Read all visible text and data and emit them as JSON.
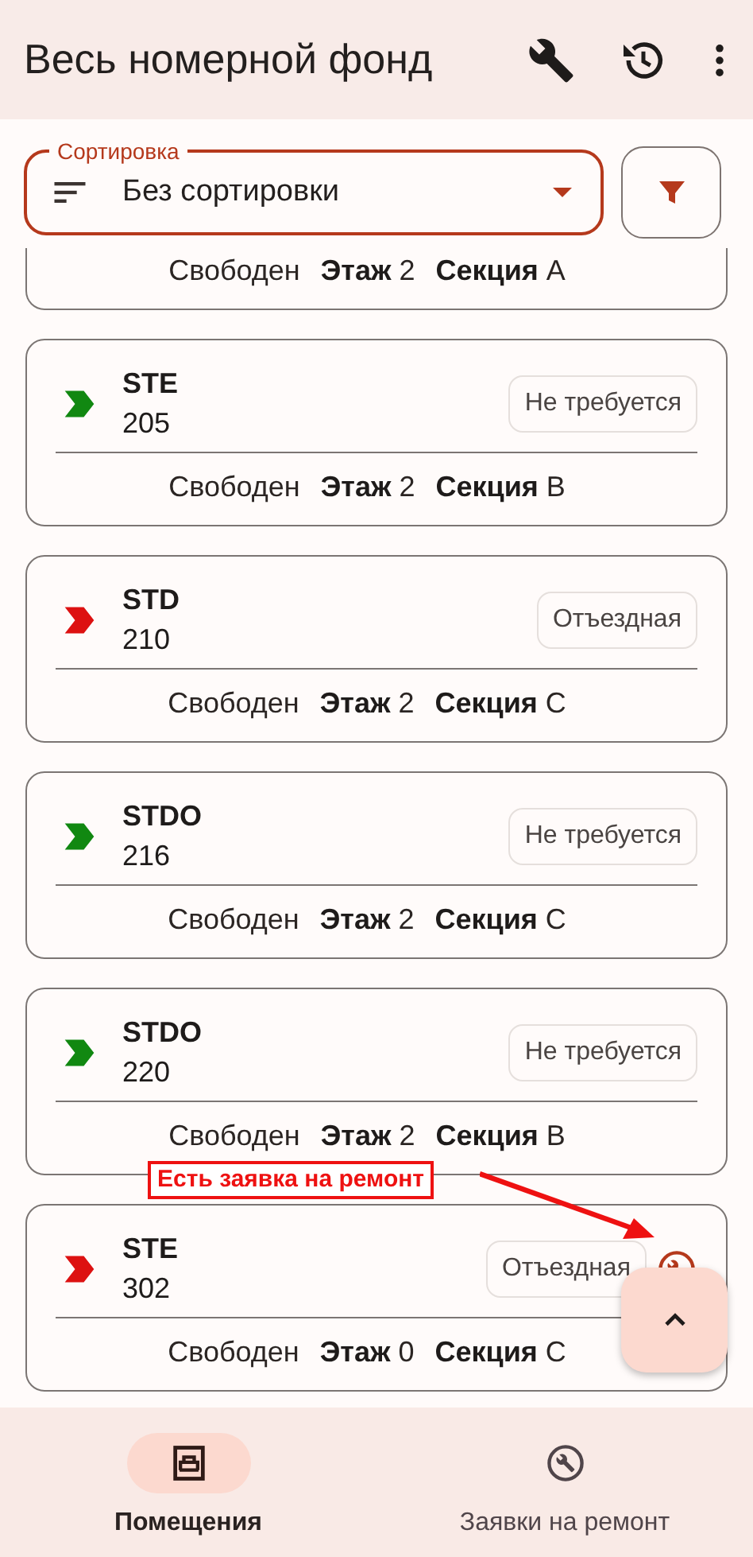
{
  "app_bar": {
    "title": "Весь номерной фонд"
  },
  "sort": {
    "label": "Сортировка",
    "value": "Без сортировки"
  },
  "rooms": [
    {
      "kind": "partial",
      "status": "Свободен",
      "floor": "**Этаж** 2",
      "section": "**Секция** A"
    },
    {
      "kind": "full",
      "type": "STE",
      "number": "205",
      "color": "#118811",
      "badge": "Не требуется",
      "repair": false,
      "status": "Свободен",
      "floor": "**Этаж** 2",
      "section": "**Секция** B"
    },
    {
      "kind": "full",
      "type": "STD",
      "number": "210",
      "color": "#dd1111",
      "badge": "Отъездная",
      "repair": false,
      "status": "Свободен",
      "floor": "**Этаж** 2",
      "section": "**Секция** C"
    },
    {
      "kind": "full",
      "type": "STDO",
      "number": "216",
      "color": "#118811",
      "badge": "Не требуется",
      "repair": false,
      "status": "Свободен",
      "floor": "**Этаж** 2",
      "section": "**Секция** C"
    },
    {
      "kind": "full",
      "type": "STDO",
      "number": "220",
      "color": "#118811",
      "badge": "Не требуется",
      "repair": false,
      "status": "Свободен",
      "floor": "**Этаж** 2",
      "section": "**Секция** B"
    },
    {
      "kind": "full",
      "type": "STE",
      "number": "302",
      "color": "#dd1111",
      "badge": "Отъездная",
      "repair": true,
      "status": "Свободен",
      "floor": "**Этаж** 0",
      "section": "**Секция** C"
    }
  ],
  "annotation": {
    "text": "Есть заявка на ремонт"
  },
  "nav": [
    {
      "label": "Помещения",
      "selected": true
    },
    {
      "label": "Заявки на ремонт",
      "selected": false
    }
  ]
}
